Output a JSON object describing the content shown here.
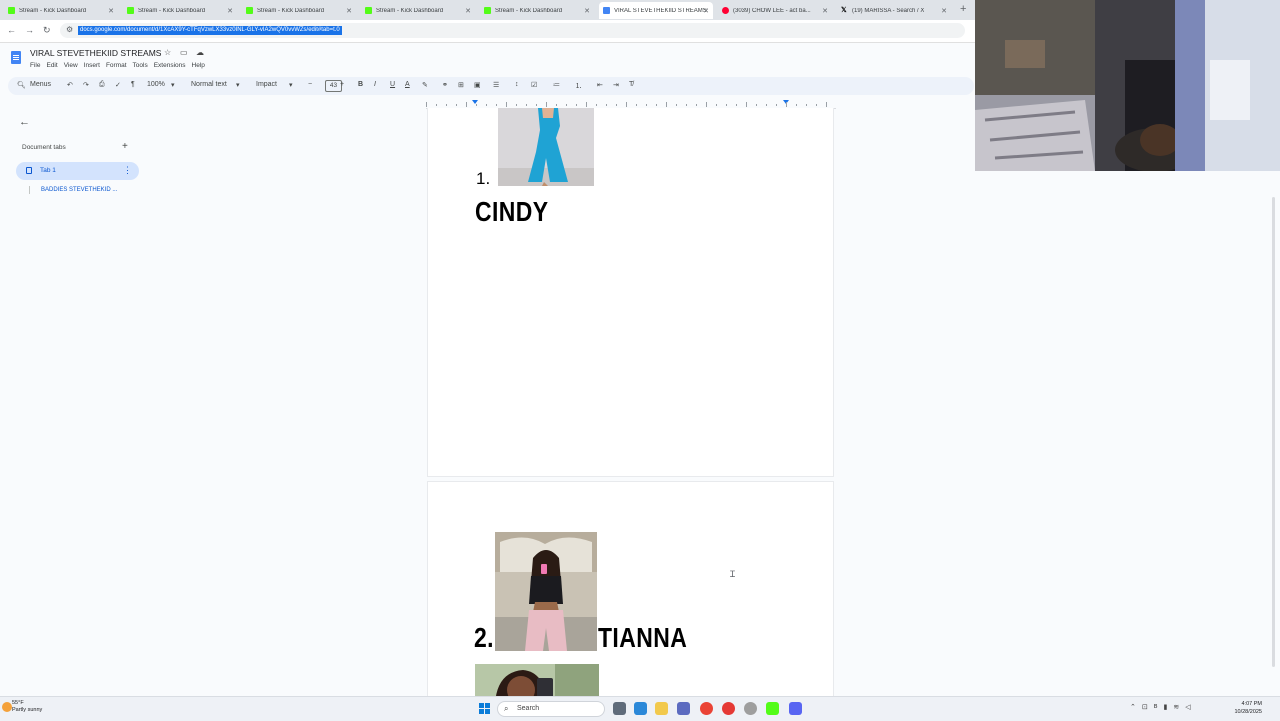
{
  "browser": {
    "tabs": [
      {
        "label": "Stream - Kick Dashboard",
        "icon": "kick-icon"
      },
      {
        "label": "Stream - Kick Dashboard",
        "icon": "kick-icon"
      },
      {
        "label": "Stream - Kick Dashboard",
        "icon": "kick-icon"
      },
      {
        "label": "Stream - Kick Dashboard",
        "icon": "kick-icon"
      },
      {
        "label": "Stream - Kick Dashboard",
        "icon": "kick-icon"
      },
      {
        "label": "VIRAL STEVETHEKIID STREAMS",
        "icon": "google-docs-icon",
        "active": true
      },
      {
        "label": "(3039) CHOW LEE - act ba...",
        "icon": "youtube-icon"
      },
      {
        "label": "(19) MARISSA - Search / X",
        "icon": "x-icon"
      }
    ],
    "url": "docs.google.com/document/d/1XcAX9Y-cTFqVzwLX33vz0INL-GLY-vIA2wQV0vvWZs/edit#tab=t.0"
  },
  "docs": {
    "title": "VIRAL STEVETHEKIID STREAMS",
    "menu": [
      "File",
      "Edit",
      "View",
      "Insert",
      "Format",
      "Tools",
      "Extensions",
      "Help"
    ],
    "toolbar": {
      "menus_label": "Menus",
      "zoom": "100%",
      "style": "Normal text",
      "font": "Impact",
      "font_size": "43"
    }
  },
  "side_panel": {
    "section_title": "Document tabs",
    "tab_label": "Tab 1",
    "outline_item": "BADDIES STEVETHEKID ..."
  },
  "document": {
    "entries": [
      {
        "number": "1.",
        "name": "CINDY"
      },
      {
        "number": "2.",
        "name": "TIANNA"
      }
    ]
  },
  "taskbar": {
    "weather_temp": "55°F",
    "weather_desc": "Partly sunny",
    "search_label": "Search",
    "time": "4:07 PM",
    "date": "10/28/2025"
  },
  "colors": {
    "accent": "#1a73e8",
    "docs_blue": "#4285f4",
    "tab_selected_bg": "#d3e3fd",
    "kick_green": "#53fc18"
  }
}
